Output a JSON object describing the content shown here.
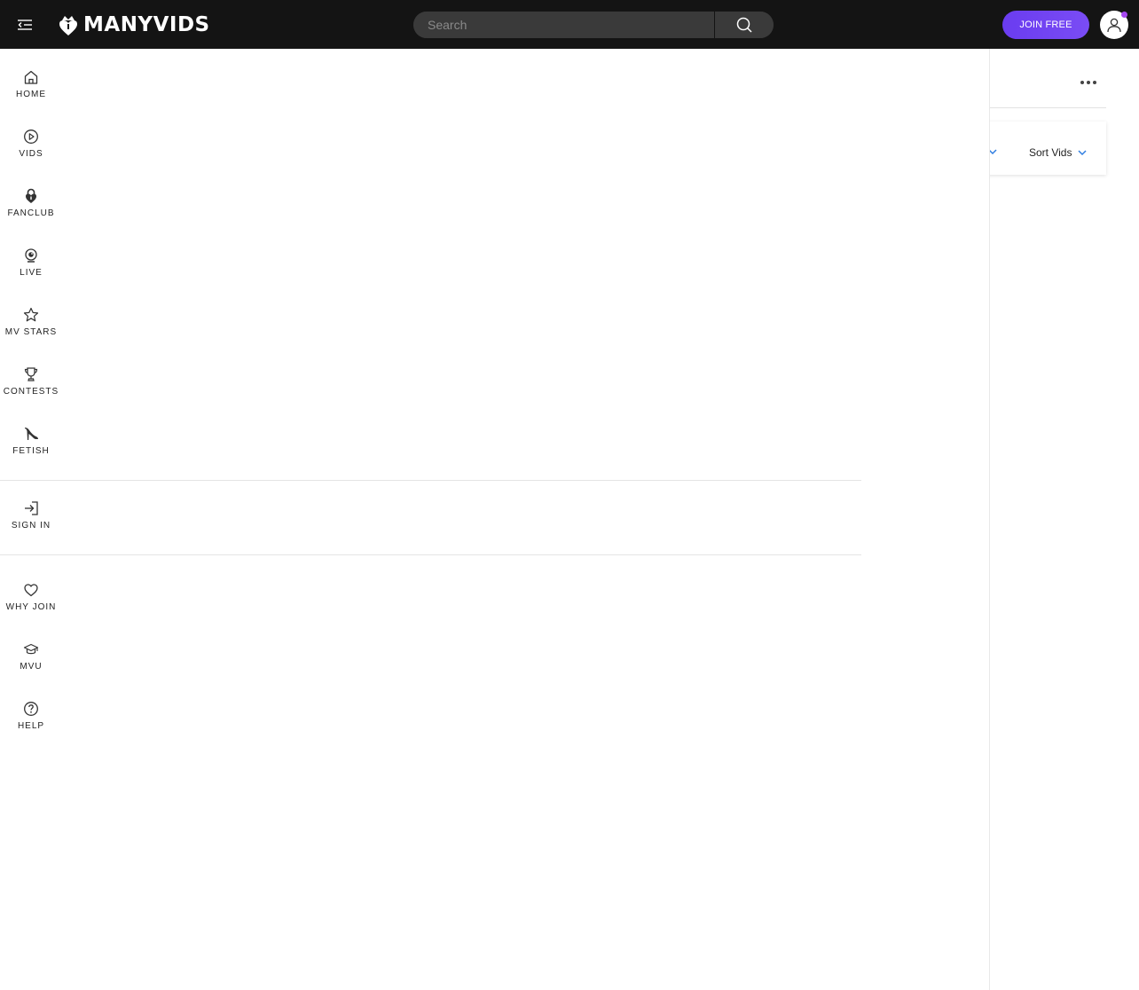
{
  "header": {
    "logo_text": "MANYVIDS",
    "search": {
      "placeholder": "Search",
      "value": ""
    },
    "join_label": "JOIN FREE",
    "accent_color": "#6a3cf0"
  },
  "background": {
    "sort_label": "Sort Vids"
  },
  "drawer": {
    "primary": [
      {
        "label": "HOME",
        "icon": "home-icon"
      },
      {
        "label": "VIDS",
        "icon": "play-circle-icon"
      },
      {
        "label": "FANCLUB",
        "icon": "lock-heart-icon"
      },
      {
        "label": "LIVE",
        "icon": "webcam-icon"
      },
      {
        "label": "MV STARS",
        "icon": "star-icon"
      },
      {
        "label": "CONTESTS",
        "icon": "trophy-icon"
      },
      {
        "label": "FETISH",
        "icon": "high-heel-icon"
      }
    ],
    "account": [
      {
        "label": "SIGN IN",
        "icon": "sign-in-icon"
      }
    ],
    "secondary": [
      {
        "label": "WHY JOIN",
        "icon": "heart-icon"
      },
      {
        "label": "MVU",
        "icon": "graduation-cap-icon"
      },
      {
        "label": "HELP",
        "icon": "help-circle-icon"
      }
    ]
  }
}
